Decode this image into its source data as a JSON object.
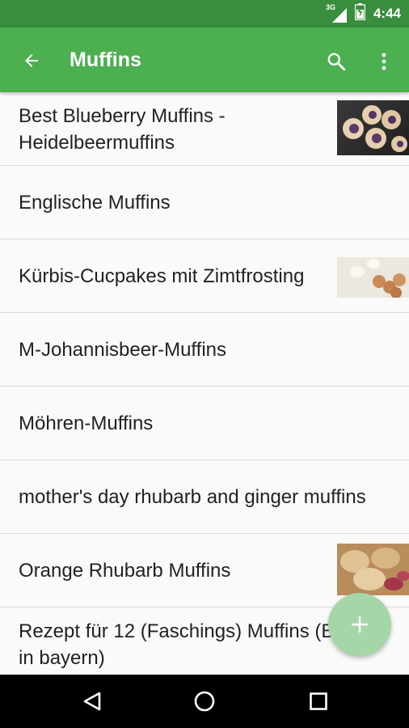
{
  "status_bar": {
    "network": "3G",
    "time": "4:44"
  },
  "app_bar": {
    "title": "Muffins"
  },
  "recipes": [
    {
      "title": "Best Blueberry Muffins - Heidelbeermuffins",
      "has_thumbnail": true
    },
    {
      "title": "Englische Muffins",
      "has_thumbnail": false
    },
    {
      "title": "Kürbis-Cucpakes mit Zimtfrosting",
      "has_thumbnail": true
    },
    {
      "title": "M-Johannisbeer-Muffins",
      "has_thumbnail": false
    },
    {
      "title": "Möhren-Muffins",
      "has_thumbnail": false
    },
    {
      "title": "mother's day rhubarb and ginger muffins",
      "has_thumbnail": false
    },
    {
      "title": "Orange Rhubarb Muffins",
      "has_thumbnail": true
    },
    {
      "title": "Rezept für 12  (Faschings) Muffins (BR-wir in bayern)",
      "has_thumbnail": false
    }
  ],
  "fab": {
    "icon": "plus-icon"
  },
  "colors": {
    "primary": "#4caf50",
    "primary_dark": "#388e3c",
    "fab": "#a5d6a7"
  },
  "icons": {
    "back": "arrow-back-icon",
    "search": "search-icon",
    "more": "more-vert-icon",
    "nav_back": "nav-back-icon",
    "nav_home": "nav-home-icon",
    "nav_recents": "nav-recents-icon"
  }
}
